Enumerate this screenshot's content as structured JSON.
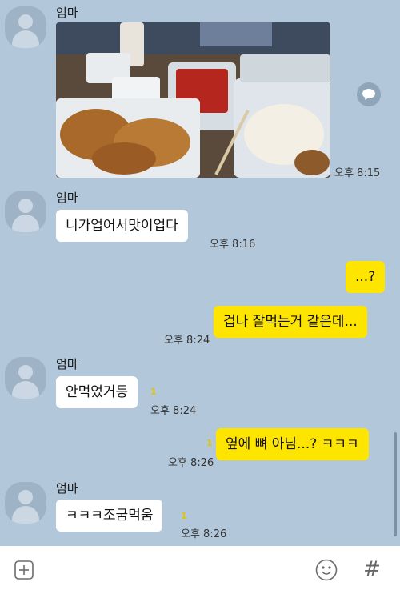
{
  "chat": {
    "messages": [
      {
        "sender": "엄마",
        "type": "photo",
        "time": "오후 8:15"
      },
      {
        "sender": "엄마",
        "text": "니가업어서맛이업다",
        "time": "오후 8:16"
      },
      {
        "text": "...?"
      },
      {
        "text": "겁나 잘먹는거 같은데...",
        "time": "오후 8:24"
      },
      {
        "sender": "엄마",
        "text": "안먹었거등",
        "unread": "1",
        "time": "오후 8:24"
      },
      {
        "text": "옆에 뼈 아님...? ㅋㅋㅋ",
        "unread": "1",
        "time": "오후 8:26"
      },
      {
        "sender": "엄마",
        "text": "ㅋㅋㅋ조굼먹움",
        "unread": "1",
        "time": "오후 8:26"
      }
    ]
  },
  "input_bar": {
    "hash_label": "#",
    "icons": [
      "plus-icon",
      "emoji-icon",
      "hash-icon"
    ]
  },
  "colors": {
    "background": "#b2c7d9",
    "incoming_bubble": "#ffffff",
    "outgoing_bubble": "#fee500",
    "unread": "#e2c400"
  }
}
